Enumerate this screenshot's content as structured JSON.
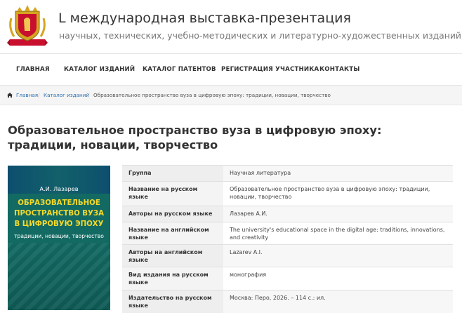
{
  "header": {
    "title": "L международная выставка-презентация",
    "subtitle": "научных, технических, учебно-методических и литературно-художественных изданий",
    "logo_icon": "crest-logo-icon"
  },
  "nav": {
    "items": [
      {
        "label": "ГЛАВНАЯ"
      },
      {
        "label": "КАТАЛОГ ИЗДАНИЙ"
      },
      {
        "label": "КАТАЛОГ ПАТЕНТОВ"
      },
      {
        "label": "РЕГИСТРАЦИЯ УЧАСТНИКА"
      },
      {
        "label": "КОНТАКТЫ"
      }
    ]
  },
  "breadcrumb": {
    "home_icon": "home-icon",
    "home": "Главная",
    "separator": "/",
    "catalog": "Каталог изданий",
    "current": "Образовательное пространство вуза в цифровую эпоху: традиции, новации, творчество"
  },
  "page": {
    "title": "Образовательное пространство вуза в цифровую эпоху: традиции, новации, творчество"
  },
  "cover": {
    "author": "А.И. Лазарев",
    "title_lines": [
      "ОБРАЗОВАТЕЛЬНОЕ",
      "ПРОСТРАНСТВО ВУЗА",
      "В ЦИФРОВУЮ ЭПОХУ"
    ],
    "subtitle": "традиции, новации, творчество"
  },
  "details": [
    {
      "key": "Группа",
      "value": "Научная литература"
    },
    {
      "key": "Название на русском языке",
      "value": "Образовательное пространство вуза в цифровую эпоху: традиции, новации, творчество"
    },
    {
      "key": "Авторы на русском языке",
      "value": "Лазарев А.И."
    },
    {
      "key": "Название на английском языке",
      "value": "The university's educational space in the digital age: traditions, innovations, and creativity"
    },
    {
      "key": "Авторы на английском языке",
      "value": "Lazarev A.I."
    },
    {
      "key": "Вид издания на русском языке",
      "value": "монография"
    },
    {
      "key": "Издательство на русском языке",
      "value": "Москва: Перо, 2026. – 114 с.: ил."
    }
  ],
  "colors": {
    "link": "#2a6fb0",
    "cover_bg": "#136a63",
    "cover_title": "#f6d928"
  }
}
